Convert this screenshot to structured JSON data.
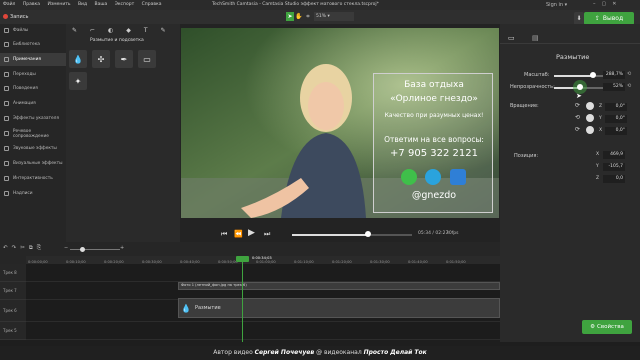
{
  "titlebar": {
    "menu": [
      "Файл",
      "Правка",
      "Изменить",
      "Вид",
      "Ваша",
      "Экспорт",
      "Справка"
    ],
    "title": "TechSmith Camtasia - Camtasia Studio эффект матового стекла.tscproj*",
    "signin": "Sign in"
  },
  "toolbar": {
    "record_label": "Запись",
    "zoom_value": "51%",
    "export_label": "Вывод",
    "accent_color": "#3fa33f"
  },
  "sidebar": {
    "items": [
      {
        "label": "Файлы",
        "icon": "files-icon"
      },
      {
        "label": "Библиотека",
        "icon": "library-icon"
      },
      {
        "label": "Примечания",
        "icon": "annotations-icon"
      },
      {
        "label": "Переходы",
        "icon": "transitions-icon"
      },
      {
        "label": "Поведения",
        "icon": "behaviors-icon"
      },
      {
        "label": "Анимация",
        "icon": "animation-icon"
      },
      {
        "label": "Эффекты указателя",
        "icon": "cursor-effects-icon"
      },
      {
        "label": "Речевое сопровождение",
        "icon": "voice-icon"
      },
      {
        "label": "Звуковые эффекты",
        "icon": "audio-effects-icon"
      },
      {
        "label": "Визуальные эффекты",
        "icon": "visual-effects-icon"
      },
      {
        "label": "Интерактивность",
        "icon": "interactivity-icon"
      },
      {
        "label": "Надписи",
        "icon": "captions-icon"
      }
    ]
  },
  "effects_panel": {
    "title": "Размытие и подсветка"
  },
  "canvas": {
    "card": {
      "line1": "База отдыха",
      "line2": "«Орлиное гнездо»",
      "line3": "Качество при разумных ценах!",
      "line4": "Ответим на все вопросы:",
      "phone": "+7 905 322 2121",
      "handle": "@gnezdo"
    }
  },
  "player": {
    "time": "05:34 / 02:27",
    "fps": "30fps",
    "progress": 0.63
  },
  "properties": {
    "title": "Размытие",
    "scale_label": "Масштаб:",
    "scale_value": "288,7%",
    "scale_fraction": 0.78,
    "opacity_label": "Непрозрачность:",
    "opacity_value": "52%",
    "opacity_fraction": 0.52,
    "rotation_label": "Вращение:",
    "rotation_z": "0,0°",
    "rotation_y": "0,0°",
    "rotation_x": "0,0°",
    "position_label": "Позиция:",
    "pos_x": "469,9",
    "pos_y": "-105,7",
    "pos_z": "0,0",
    "axis_x": "X",
    "axis_y": "Y",
    "axis_z": "Z",
    "properties_button": "Свойства"
  },
  "timeline": {
    "ticks": [
      "0:00:00;00",
      "0:00:10;00",
      "0:00:20;00",
      "0:00:30;00",
      "0:00:40;00",
      "0:00:50;00",
      "0:01:00;00",
      "0:01:10;00",
      "0:01:20;00",
      "0:01:30;00",
      "0:01:40;00",
      "0:01:50;00"
    ],
    "playhead_time": "0:00:34;03",
    "tracks": [
      "Трек 8",
      "Трек 7",
      "Трек 6",
      "Трек 5"
    ],
    "clip1_label": "Фото 1 (летний_фон.jpg на трек 6)",
    "clip2_label": "Размытие"
  },
  "caption": {
    "prefix": "Автор видео",
    "author": "Сергей Почечуев",
    "middle": "@ видеоканал",
    "channel": "Просто Делай Ток"
  }
}
